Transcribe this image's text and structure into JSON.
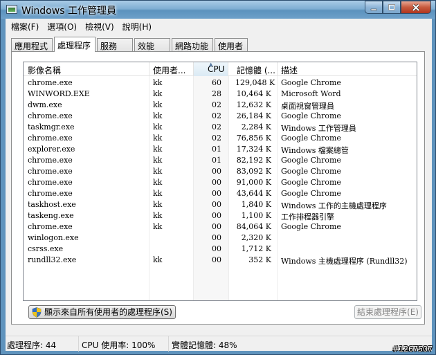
{
  "window": {
    "title": "Windows 工作管理員"
  },
  "menu": [
    {
      "label": "檔案(F)"
    },
    {
      "label": "選項(O)"
    },
    {
      "label": "檢視(V)"
    },
    {
      "label": "說明(H)"
    }
  ],
  "tabs": [
    {
      "label": "應用程式",
      "active": false
    },
    {
      "label": "處理程序",
      "active": true
    },
    {
      "label": "服務",
      "active": false
    },
    {
      "label": "效能",
      "active": false
    },
    {
      "label": "網路功能",
      "active": false
    },
    {
      "label": "使用者",
      "active": false
    }
  ],
  "columns": {
    "name": "影像名稱",
    "user": "使用者...",
    "cpu": "CPU",
    "memory": "記憶體 (...",
    "description": "描述"
  },
  "processes": [
    {
      "name": "chrome.exe",
      "user": "kk",
      "cpu": "60",
      "memory": "129,048 K",
      "description": "Google Chrome"
    },
    {
      "name": "WINWORD.EXE",
      "user": "kk",
      "cpu": "28",
      "memory": "10,464 K",
      "description": "Microsoft Word"
    },
    {
      "name": "dwm.exe",
      "user": "kk",
      "cpu": "02",
      "memory": "12,632 K",
      "description": "桌面視窗管理員"
    },
    {
      "name": "chrome.exe",
      "user": "kk",
      "cpu": "02",
      "memory": "26,184 K",
      "description": "Google Chrome"
    },
    {
      "name": "taskmgr.exe",
      "user": "kk",
      "cpu": "02",
      "memory": "2,284 K",
      "description": "Windows 工作管理員"
    },
    {
      "name": "chrome.exe",
      "user": "kk",
      "cpu": "02",
      "memory": "76,856 K",
      "description": "Google Chrome"
    },
    {
      "name": "explorer.exe",
      "user": "kk",
      "cpu": "01",
      "memory": "17,324 K",
      "description": "Windows 檔案總管"
    },
    {
      "name": "chrome.exe",
      "user": "kk",
      "cpu": "01",
      "memory": "82,192 K",
      "description": "Google Chrome"
    },
    {
      "name": "chrome.exe",
      "user": "kk",
      "cpu": "00",
      "memory": "83,092 K",
      "description": "Google Chrome"
    },
    {
      "name": "chrome.exe",
      "user": "kk",
      "cpu": "00",
      "memory": "91,000 K",
      "description": "Google Chrome"
    },
    {
      "name": "chrome.exe",
      "user": "kk",
      "cpu": "00",
      "memory": "43,644 K",
      "description": "Google Chrome"
    },
    {
      "name": "taskhost.exe",
      "user": "kk",
      "cpu": "00",
      "memory": "1,840 K",
      "description": "Windows 工作的主機處理程序"
    },
    {
      "name": "taskeng.exe",
      "user": "kk",
      "cpu": "00",
      "memory": "1,100 K",
      "description": "工作排程器引擎"
    },
    {
      "name": "chrome.exe",
      "user": "kk",
      "cpu": "00",
      "memory": "84,064 K",
      "description": "Google Chrome"
    },
    {
      "name": "winlogon.exe",
      "user": "",
      "cpu": "00",
      "memory": "2,320 K",
      "description": ""
    },
    {
      "name": "csrss.exe",
      "user": "",
      "cpu": "00",
      "memory": "1,712 K",
      "description": ""
    },
    {
      "name": "rundll32.exe",
      "user": "kk",
      "cpu": "00",
      "memory": "352 K",
      "description": "Windows 主機處理程序 (Rundll32)"
    }
  ],
  "buttons": {
    "show_all": "顯示來自所有使用者的處理程序(S)",
    "end_process": "結束處理程序(E)"
  },
  "status": {
    "processes": "處理程序: 44",
    "cpu": "CPU 使用率: 100%",
    "memory": "實體記憶體: 48%"
  },
  "watermark": "#1267507",
  "icons": [
    "task-manager-icon",
    "uac-shield-icon",
    "sort-ascending-icon"
  ],
  "colors": {
    "titlebar": "#6da0c9",
    "close_button": "#c75a3e",
    "panel": "#ffffff",
    "chrome": "#f0f0f0"
  }
}
